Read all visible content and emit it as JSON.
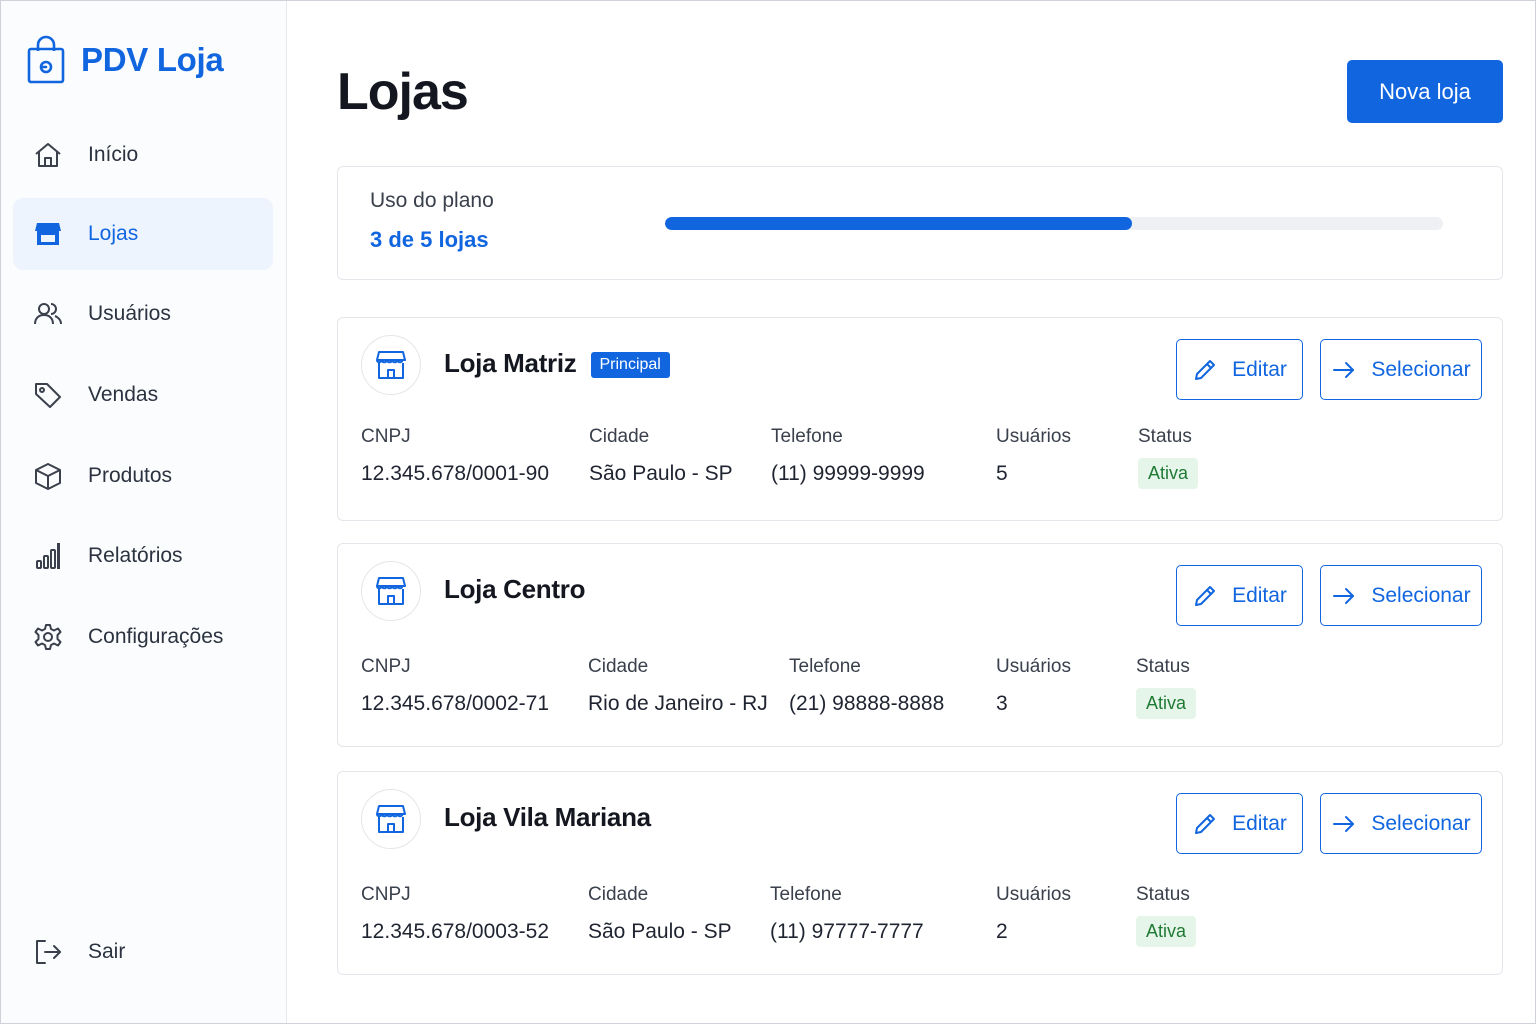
{
  "app": {
    "name": "PDV Loja"
  },
  "sidebar": {
    "items": [
      {
        "label": "Início",
        "icon": "home-icon",
        "active": false
      },
      {
        "label": "Lojas",
        "icon": "store-icon",
        "active": true
      },
      {
        "label": "Usuários",
        "icon": "users-icon",
        "active": false
      },
      {
        "label": "Vendas",
        "icon": "tag-icon",
        "active": false
      },
      {
        "label": "Produtos",
        "icon": "box-icon",
        "active": false
      },
      {
        "label": "Relatórios",
        "icon": "bar-chart-icon",
        "active": false
      },
      {
        "label": "Configurações",
        "icon": "gear-icon",
        "active": false
      }
    ],
    "logout": {
      "label": "Sair",
      "icon": "logout-icon"
    }
  },
  "header": {
    "title": "Lojas",
    "new_store_label": "Nova loja"
  },
  "plan": {
    "label": "Uso do plano",
    "value": "3 de 5 lojas",
    "used": 3,
    "total": 5
  },
  "store_fields": {
    "cnpj": "CNPJ",
    "city": "Cidade",
    "phone": "Telefone",
    "users": "Usuários",
    "status": "Status"
  },
  "store_actions": {
    "edit": "Editar",
    "select": "Selecionar"
  },
  "stores": [
    {
      "name": "Loja Matriz",
      "badge": "Principal",
      "cnpj": "12.345.678/0001-90",
      "city": "São Paulo - SP",
      "phone": "(11) 99999-9999",
      "users": "5",
      "status": "Ativa"
    },
    {
      "name": "Loja Centro",
      "badge": "",
      "cnpj": "12.345.678/0002-71",
      "city": "Rio de Janeiro - RJ",
      "phone": "(21) 98888-8888",
      "users": "3",
      "status": "Ativa"
    },
    {
      "name": "Loja Vila Mariana",
      "badge": "",
      "cnpj": "12.345.678/0003-52",
      "city": "São Paulo - SP",
      "phone": "(11) 97777-7777",
      "users": "2",
      "status": "Ativa"
    }
  ],
  "colors": {
    "accent": "#1166e0",
    "status_bg": "#e6f5e9",
    "status_text": "#1f7a35"
  }
}
